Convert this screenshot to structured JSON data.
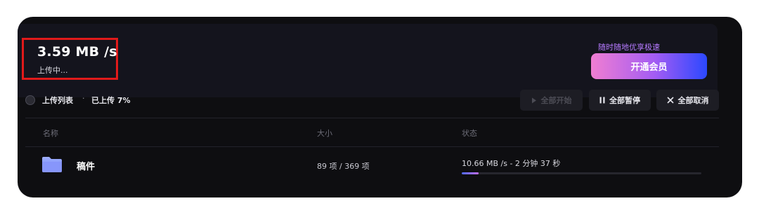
{
  "banner": {
    "speed": "3.59 MB /s",
    "status": "上传中...",
    "promo": "随时随地优享极速",
    "vip_button": "开通会员",
    "accent_colors": [
      "#f07ed2",
      "#a35cf3",
      "#2b48ff"
    ]
  },
  "list": {
    "title": "上传列表",
    "separator": "·",
    "uploaded": "已上传 7%",
    "actions": {
      "start_all": "全部开始",
      "pause_all": "全部暂停",
      "cancel_all": "全部取消"
    },
    "columns": [
      "名称",
      "大小",
      "状态"
    ],
    "rows": [
      {
        "icon": "folder-icon",
        "name": "稿件",
        "size": "89 项 / 369 项",
        "status": "10.66 MB /s - 2 分钟 37 秒",
        "progress": 0.07
      }
    ]
  },
  "icons": {
    "start": "play-icon",
    "pause": "pause-icon",
    "cancel": "close-icon"
  },
  "highlight_color": "#e11a1a"
}
